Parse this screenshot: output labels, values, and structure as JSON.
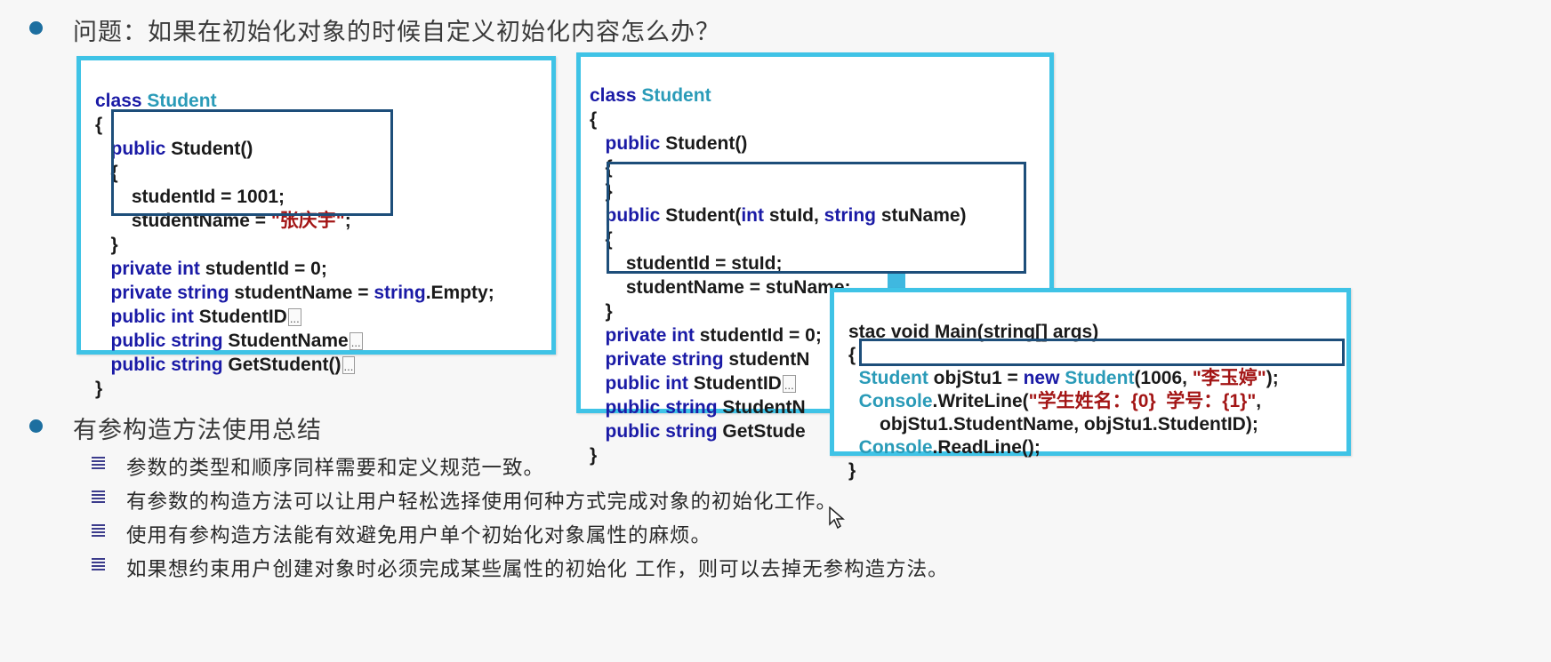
{
  "heading1": "问题：如果在初始化对象的时候自定义初始化内容怎么办？",
  "heading2": "有参构造方法使用总结",
  "bullets": [
    "参数的类型和顺序同样需要和定义规范一致。",
    "有参数的构造方法可以让用户轻松选择使用何种方式完成对象的初始化工作。",
    "使用有参构造方法能有效避免用户单个初始化对象属性的麻烦。",
    "如果想约束用户创建对象时必须完成某些属性的初始化  工作，则可以去掉无参构造方法。"
  ],
  "code_left": {
    "kw_class": "class",
    "type_student": "Student",
    "open_brace": "{",
    "close_brace": "}",
    "kw_public": "public",
    "kw_private": "private",
    "kw_int": "int",
    "kw_string": "string",
    "ctor_sig": " Student()",
    "ctor_line1": "    studentId = 1001;",
    "ctor_line2_prefix": "    studentName = ",
    "ctor_line2_str": "\"张庆宇\"",
    "ctor_line2_suffix": ";",
    "field1": " studentId = 0;",
    "field2_a": " studentName = ",
    "field2_b": ".Empty;",
    "prop1": " StudentID",
    "prop2": " StudentName",
    "method": " GetStudent()",
    "ellipsis": "..."
  },
  "code_right": {
    "kw_class": "class",
    "type_student": "Student",
    "open_brace": "{",
    "close_brace": "}",
    "kw_public": "public",
    "kw_private": "private",
    "kw_int": "int",
    "kw_string": "string",
    "ctor1_sig": " Student()",
    "ctor2_a": " Student(",
    "ctor2_b": " stuId, ",
    "ctor2_c": " stuName)",
    "ctor2_line1": "    studentId = stuId;",
    "ctor2_line2": "    studentName = stuName;",
    "field1": " studentId = 0;",
    "field2": " studentN",
    "prop1": " StudentID",
    "prop2": " StudentN",
    "method": " GetStude",
    "ellipsis": "..."
  },
  "code_main": {
    "sig_a": "sta",
    "sig_b": "c void Main(string[] args)",
    "open_brace": "{",
    "close_brace": "}",
    "type_student": "Student",
    "new_a": " objStu1 = ",
    "kw_new": "new",
    "new_b": "(1006, ",
    "new_str": "\"李玉婷\"",
    "new_c": ");",
    "console": "Console",
    "writeline_a": ".WriteLine(",
    "writeline_str": "\"学生姓名：{0}  学号：{1}\"",
    "writeline_c": ",",
    "writeline_line2": "    objStu1.StudentName, objStu1.StudentID);",
    "readline": ".ReadLine();"
  },
  "colors": {
    "box_border": "#3fc3e6",
    "inner_border": "#1d4e7a",
    "keyword": "#1a1aa6",
    "type": "#2a9bb8",
    "string": "#a31515",
    "bullet": "#1d6fa0",
    "arrow": "#3fb8e0"
  },
  "icons": [
    "bullet-dot-icon",
    "list-bullet-icon",
    "down-arrow-icon",
    "mouse-cursor-icon"
  ]
}
